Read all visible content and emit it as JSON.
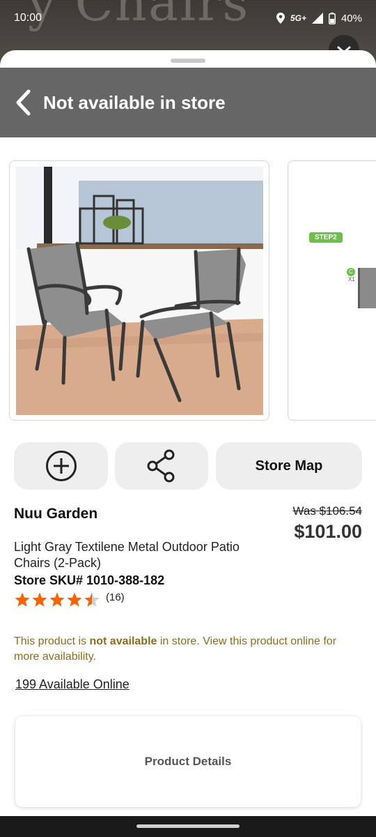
{
  "status_bar": {
    "time": "10:00",
    "network": "5G+",
    "battery": "40%"
  },
  "backdrop_text": "y Chairs",
  "header": {
    "title": "Not available in store"
  },
  "carousel": {
    "step_badge": "STEP2",
    "part_letter": "C",
    "part_qty": "X1"
  },
  "actions": {
    "store_map_label": "Store Map"
  },
  "product": {
    "brand": "Nuu Garden",
    "was_price": "Was  $106.54",
    "price": "$101.00",
    "name": "Light Gray Textilene Metal Outdoor Patio Chairs (2-Pack)",
    "sku": "Store SKU# 1010-388-182",
    "rating": 4.5,
    "reviews": "(16)"
  },
  "availability": {
    "notice_prefix": "This product is ",
    "notice_bold": "not available",
    "notice_suffix": " in store. View this product online for more availability.",
    "online_link": "199 Available Online"
  },
  "details": {
    "label": "Product Details"
  },
  "colors": {
    "header_bg": "#666666",
    "star": "#f96302",
    "notice": "#8a6d1f",
    "step_badge": "#6cc04a"
  }
}
